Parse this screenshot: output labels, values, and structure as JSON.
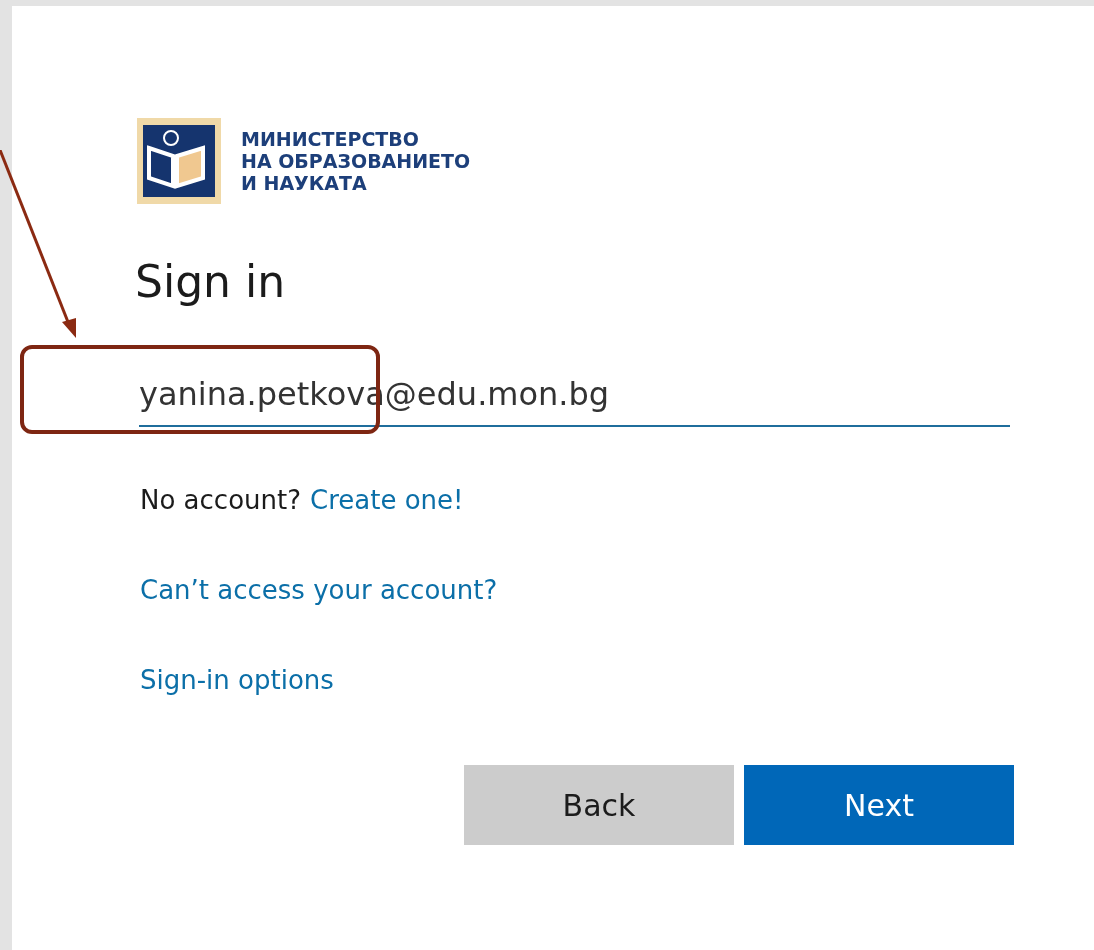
{
  "logo": {
    "lines": [
      "МИНИСТЕРСТВО",
      "НА ОБРАЗОВАНИЕТО",
      "И НАУКАТА"
    ]
  },
  "title": "Sign in",
  "email_field": {
    "value": "yanina.petkova@edu.mon.bg"
  },
  "no_account": {
    "text": "No account?",
    "link": "Create one!"
  },
  "links": [
    "Can’t access your account?",
    "Sign-in options"
  ],
  "buttons": [
    {
      "label": "Back",
      "kind": "secondary"
    },
    {
      "label": "Next",
      "kind": "primary"
    }
  ]
}
